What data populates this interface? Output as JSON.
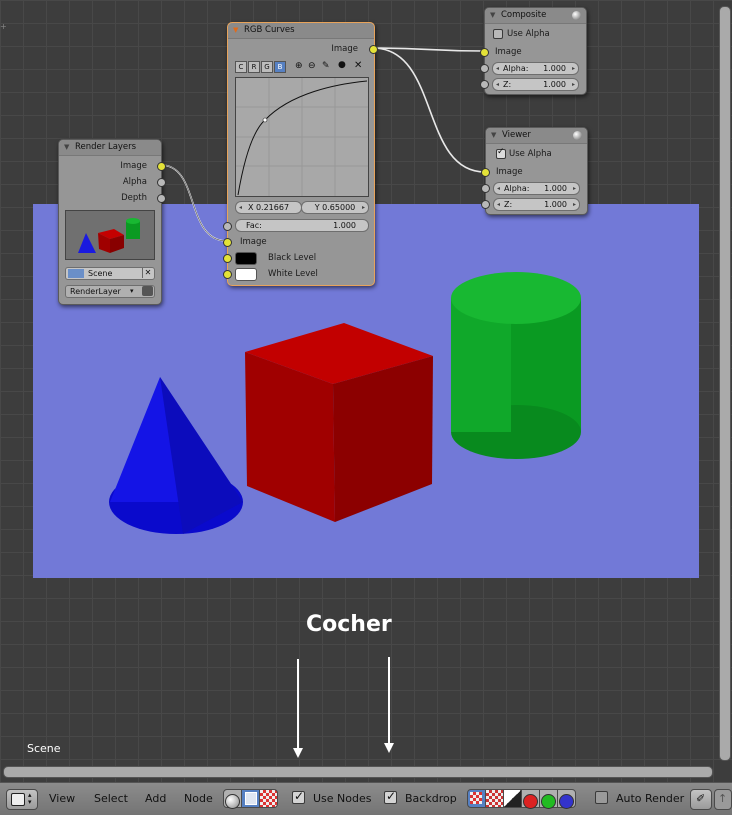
{
  "nodes": {
    "render_layers": {
      "title": "Render Layers",
      "outputs": [
        "Image",
        "Alpha",
        "Depth"
      ],
      "scene": "Scene",
      "layer": "RenderLayer"
    },
    "rgb_curves": {
      "title": "RGB Curves",
      "output": "Image",
      "channels": [
        "C",
        "R",
        "G",
        "B"
      ],
      "x_value": "X 0.21667",
      "y_value": "Y 0.65000",
      "fac_label": "Fac:",
      "fac_value": "1.000",
      "inputs": [
        "Image",
        "Black Level",
        "White Level"
      ]
    },
    "composite": {
      "title": "Composite",
      "use_alpha": "Use Alpha",
      "input": "Image",
      "alpha_label": "Alpha:",
      "alpha_value": "1.000",
      "z_label": "Z:",
      "z_value": "1.000"
    },
    "viewer": {
      "title": "Viewer",
      "use_alpha": "Use Alpha",
      "input": "Image",
      "alpha_label": "Alpha:",
      "alpha_value": "1.000",
      "z_label": "Z:",
      "z_value": "1.000"
    }
  },
  "annotation": "Cocher",
  "scene_label": "Scene",
  "header": {
    "menus": [
      "View",
      "Select",
      "Add",
      "Node"
    ],
    "use_nodes": "Use Nodes",
    "backdrop": "Backdrop",
    "auto_render": "Auto Render"
  },
  "colors": {
    "backdrop": "#7279d7",
    "cone": "#1010e0",
    "cube": "#b00000",
    "cylinder": "#10a030",
    "socket_yellow": "#e3e238",
    "socket_grey": "#b8b8b8",
    "active_border": "#e8a35a"
  }
}
